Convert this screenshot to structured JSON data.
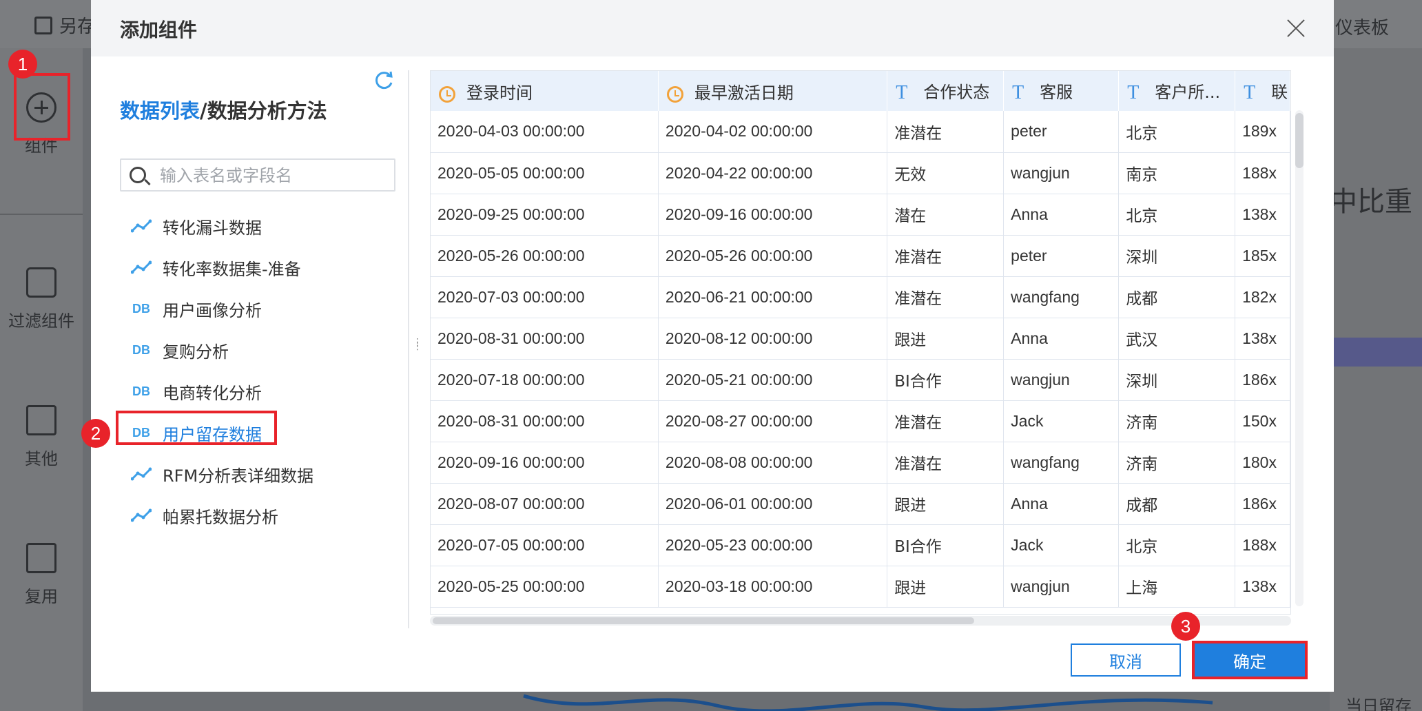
{
  "background": {
    "toolbar_save": "另存",
    "toolbar_right": "仪表板",
    "sidebar": [
      {
        "label": "组件",
        "icon": "plus-circle-icon"
      },
      {
        "label": "过滤组件",
        "icon": "cube-icon"
      },
      {
        "label": "其他",
        "icon": "document-icon"
      },
      {
        "label": "复用",
        "icon": "copy-icon"
      }
    ],
    "right_partial_text": "中比重",
    "legend_text": "当日留存率"
  },
  "steps": [
    "1",
    "2",
    "3"
  ],
  "dialog": {
    "title": "添加组件",
    "heading_link": "数据列表",
    "heading_rest": "/数据分析方法",
    "search_placeholder": "输入表名或字段名",
    "datasets": [
      {
        "label": "转化漏斗数据",
        "icon": "analysis-icon"
      },
      {
        "label": "转化率数据集-准备",
        "icon": "analysis-icon"
      },
      {
        "label": "用户画像分析",
        "icon": "db-icon"
      },
      {
        "label": "复购分析",
        "icon": "db-icon"
      },
      {
        "label": "电商转化分析",
        "icon": "db-icon"
      },
      {
        "label": "用户留存数据",
        "icon": "db-icon",
        "selected": true
      },
      {
        "label": "RFM分析表详细数据",
        "icon": "analysis-icon"
      },
      {
        "label": "帕累托数据分析",
        "icon": "analysis-icon"
      }
    ],
    "table": {
      "columns": [
        {
          "label": "登录时间",
          "type": "date"
        },
        {
          "label": "最早激活日期",
          "type": "date"
        },
        {
          "label": "合作状态",
          "type": "text"
        },
        {
          "label": "客服",
          "type": "text"
        },
        {
          "label": "客户所...",
          "type": "text"
        },
        {
          "label": "联",
          "type": "text"
        }
      ],
      "rows": [
        [
          "2020-04-03 00:00:00",
          "2020-04-02 00:00:00",
          "准潜在",
          "peter",
          "北京",
          "189x"
        ],
        [
          "2020-05-05 00:00:00",
          "2020-04-22 00:00:00",
          "无效",
          "wangjun",
          "南京",
          "188x"
        ],
        [
          "2020-09-25 00:00:00",
          "2020-09-16 00:00:00",
          "潜在",
          "Anna",
          "北京",
          "138x"
        ],
        [
          "2020-05-26 00:00:00",
          "2020-05-26 00:00:00",
          "准潜在",
          "peter",
          "深圳",
          "185x"
        ],
        [
          "2020-07-03 00:00:00",
          "2020-06-21 00:00:00",
          "准潜在",
          "wangfang",
          "成都",
          "182x"
        ],
        [
          "2020-08-31 00:00:00",
          "2020-08-12 00:00:00",
          "跟进",
          "Anna",
          "武汉",
          "138x"
        ],
        [
          "2020-07-18 00:00:00",
          "2020-05-21 00:00:00",
          "BI合作",
          "wangjun",
          "深圳",
          "186x"
        ],
        [
          "2020-08-31 00:00:00",
          "2020-08-27 00:00:00",
          "准潜在",
          "Jack",
          "济南",
          "150x"
        ],
        [
          "2020-09-16 00:00:00",
          "2020-08-08 00:00:00",
          "准潜在",
          "wangfang",
          "济南",
          "180x"
        ],
        [
          "2020-08-07 00:00:00",
          "2020-06-01 00:00:00",
          "跟进",
          "Anna",
          "成都",
          "186x"
        ],
        [
          "2020-07-05 00:00:00",
          "2020-05-23 00:00:00",
          "BI合作",
          "Jack",
          "北京",
          "188x"
        ],
        [
          "2020-05-25 00:00:00",
          "2020-03-18 00:00:00",
          "跟进",
          "wangjun",
          "上海",
          "138x"
        ]
      ]
    },
    "cancel_label": "取消",
    "ok_label": "确定"
  },
  "colors": {
    "accent": "#1f7fde",
    "annotation": "#e8232a",
    "date_icon": "#f2a23a",
    "header_bg": "#e9f1fb"
  }
}
